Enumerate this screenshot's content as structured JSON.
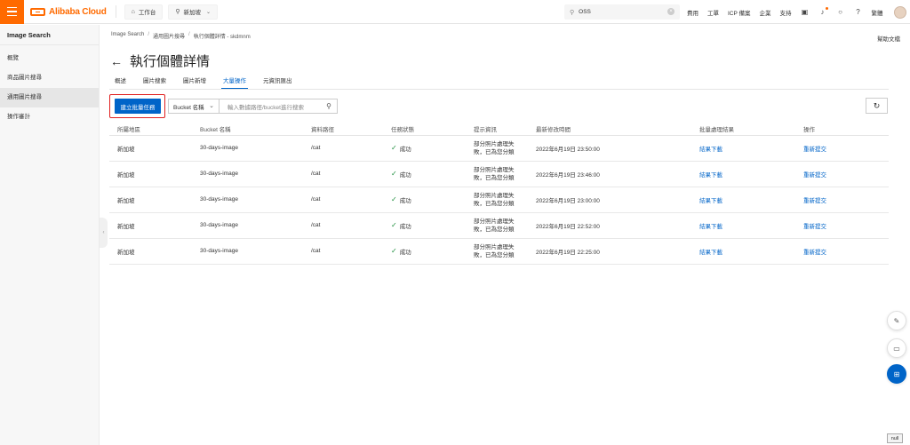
{
  "topbar": {
    "brand": "Alibaba Cloud",
    "workbench": "工作台",
    "region": "新加坡",
    "search_value": "OSS",
    "nav": [
      "費用",
      "工單",
      "ICP 備案",
      "企業",
      "支持"
    ],
    "lang": "繁體"
  },
  "sidebar": {
    "title": "Image Search",
    "items": [
      {
        "label": "概覽"
      },
      {
        "label": "商品圖片搜尋"
      },
      {
        "label": "通用圖片搜尋"
      },
      {
        "label": "操作審計"
      }
    ]
  },
  "main": {
    "breadcrumb": [
      "Image Search",
      "通用圖片搜尋",
      "執行個體詳情 - skdmnm"
    ],
    "help": "幫助文檔",
    "title": "執行個體詳情",
    "tabs": [
      "概述",
      "圖片搜索",
      "圖片新增",
      "大量操作",
      "元資訊匯出"
    ],
    "create_button": "建立批量任務",
    "select_value": "Bucket 名稱",
    "filter_placeholder": "輸入數據路徑/bucket進行搜索",
    "columns": [
      "所屬地區",
      "Bucket 名稱",
      "資料路徑",
      "任務狀態",
      "提示資訊",
      "最新修改時間",
      "批量處理結果",
      "操作"
    ],
    "rows": [
      {
        "region": "新加坡",
        "bucket": "30-days-image",
        "path": "/cat",
        "status": "成功",
        "tip": "部分照片處理失敗，已為您分類",
        "time": "2022年6月19日 23:50:00",
        "result": "結果下載",
        "action": "重新提交"
      },
      {
        "region": "新加坡",
        "bucket": "30-days-image",
        "path": "/cat",
        "status": "成功",
        "tip": "部分照片處理失敗，已為您分類",
        "time": "2022年6月19日 23:46:00",
        "result": "結果下載",
        "action": "重新提交"
      },
      {
        "region": "新加坡",
        "bucket": "30-days-image",
        "path": "/cat",
        "status": "成功",
        "tip": "部分照片處理失敗，已為您分類",
        "time": "2022年6月19日 23:00:00",
        "result": "結果下載",
        "action": "重新提交"
      },
      {
        "region": "新加坡",
        "bucket": "30-days-image",
        "path": "/cat",
        "status": "成功",
        "tip": "部分照片處理失敗，已為您分類",
        "time": "2022年6月19日 22:52:00",
        "result": "結果下載",
        "action": "重新提交"
      },
      {
        "region": "新加坡",
        "bucket": "30-days-image",
        "path": "/cat",
        "status": "成功",
        "tip": "部分照片處理失敗，已為您分類",
        "time": "2022年6月19日 22:25:00",
        "result": "結果下載",
        "action": "重新提交"
      }
    ]
  },
  "badge": "null"
}
